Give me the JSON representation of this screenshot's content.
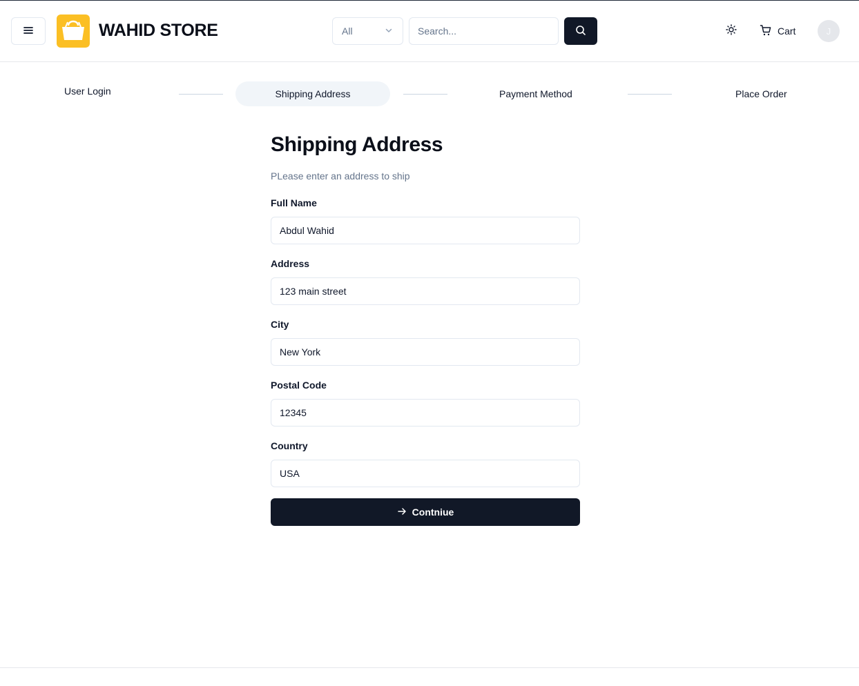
{
  "header": {
    "brand": "WAHID STORE",
    "category": {
      "selected": "All"
    },
    "search": {
      "placeholder": "Search...",
      "value": ""
    },
    "cart_label": "Cart",
    "avatar_initial": "J"
  },
  "stepper": {
    "steps": [
      {
        "label": "User Login",
        "active": false
      },
      {
        "label": "Shipping Address",
        "active": true
      },
      {
        "label": "Payment Method",
        "active": false
      },
      {
        "label": "Place Order",
        "active": false
      }
    ]
  },
  "form": {
    "title": "Shipping Address",
    "subtitle": "PLease enter an address to ship",
    "fields": [
      {
        "label": "Full Name",
        "value": "Abdul Wahid"
      },
      {
        "label": "Address",
        "value": "123 main street"
      },
      {
        "label": "City",
        "value": "New York"
      },
      {
        "label": "Postal Code",
        "value": "12345"
      },
      {
        "label": "Country",
        "value": "USA"
      }
    ],
    "submit_label": "Contniue"
  },
  "colors": {
    "brand_logo": "#fbbf24",
    "primary_button": "#111827",
    "active_step_bg": "#f1f5f9",
    "muted_text": "#64748b"
  },
  "icons": [
    "menu-icon",
    "shopping-bag-icon",
    "chevron-down-icon",
    "search-icon",
    "sun-icon",
    "cart-icon",
    "arrow-right-icon"
  ]
}
